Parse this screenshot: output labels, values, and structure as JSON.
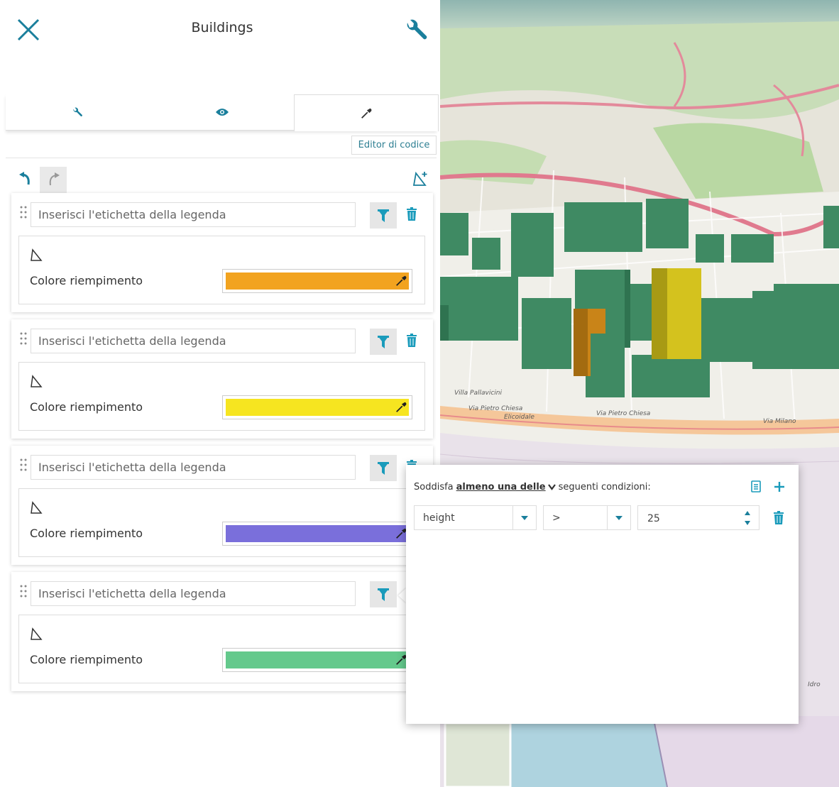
{
  "header": {
    "title": "Buildings"
  },
  "code_editor_label": "Editor di codice",
  "rules": [
    {
      "placeholder": "Inserisci l'etichetta della legenda",
      "fill_label": "Colore riempimento",
      "color": "#f2a31f"
    },
    {
      "placeholder": "Inserisci l'etichetta della legenda",
      "fill_label": "Colore riempimento",
      "color": "#f6e520"
    },
    {
      "placeholder": "Inserisci l'etichetta della legenda",
      "fill_label": "Colore riempimento",
      "color": "#7a6fdb"
    },
    {
      "placeholder": "Inserisci l'etichetta della legenda",
      "fill_label": "Colore riempimento",
      "color": "#64c98c"
    }
  ],
  "filter_popup": {
    "prefix": "Soddisfa",
    "mode": "almeno una delle",
    "suffix": "seguenti condizioni:",
    "condition": {
      "attribute": "height",
      "operator": ">",
      "value": "25"
    }
  },
  "map": {
    "street_labels": [
      "Via Pietro Chiesa",
      "Via Pietro Chiesa",
      "Elicoidale",
      "Via Milano",
      "Villa Pallavicini",
      "Idro"
    ]
  },
  "colors": {
    "accent": "#1a9bbb",
    "primary_teal": "#1a7f9c"
  }
}
